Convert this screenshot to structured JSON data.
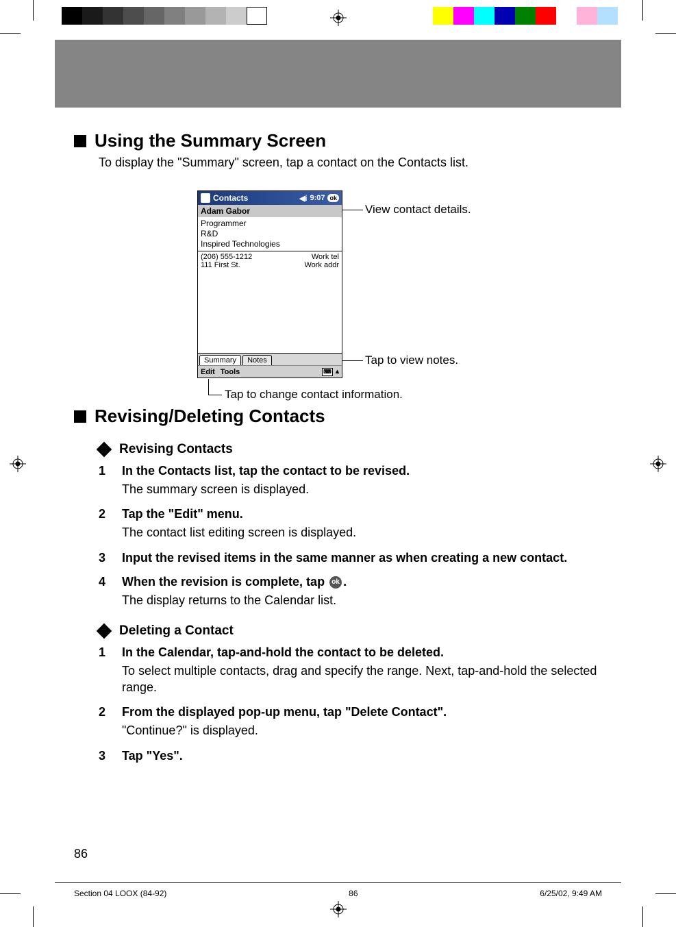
{
  "section1": {
    "heading": "Using the Summary Screen",
    "intro": "To display the \"Summary\" screen, tap a contact on the Contacts list."
  },
  "ppc": {
    "title": "Contacts",
    "time": "9:07",
    "ok": "ok",
    "name": "Adam Gabor",
    "role": "Programmer",
    "dept": "R&D",
    "company": "Inspired Technologies",
    "phone": "(206) 555-1212",
    "phone_label": "Work tel",
    "addr": "111 First St.",
    "addr_label": "Work addr",
    "tab_summary": "Summary",
    "tab_notes": "Notes",
    "menu_edit": "Edit",
    "menu_tools": "Tools"
  },
  "callouts": {
    "view_details": "View contact details.",
    "view_notes": "Tap to view notes.",
    "change_info": "Tap to change contact information."
  },
  "section2": {
    "heading": "Revising/Deleting Contacts"
  },
  "revising": {
    "heading": "Revising Contacts",
    "steps": [
      {
        "num": "1",
        "title": "In the Contacts list, tap the contact to be revised.",
        "body": "The summary screen is displayed."
      },
      {
        "num": "2",
        "title": "Tap the \"Edit\" menu.",
        "body": "The contact list editing screen is displayed."
      },
      {
        "num": "3",
        "title": "Input the revised items in the same manner as when creating a new contact.",
        "body": ""
      },
      {
        "num": "4",
        "title_pre": "When the revision is complete, tap ",
        "title_post": ".",
        "body": "The display returns to the Calendar list."
      }
    ]
  },
  "deleting": {
    "heading": "Deleting a Contact",
    "steps": [
      {
        "num": "1",
        "title": "In the Calendar, tap-and-hold the contact to be deleted.",
        "body": "To select multiple contacts, drag and specify the range. Next, tap-and-hold the selected range."
      },
      {
        "num": "2",
        "title": "From the displayed pop-up menu, tap \"Delete Contact\".",
        "body": "\"Continue?\" is displayed."
      },
      {
        "num": "3",
        "title": "Tap \"Yes\".",
        "body": ""
      }
    ]
  },
  "page_number": "86",
  "footer": {
    "left": "Section 04 LOOX (84-92)",
    "center": "86",
    "right": "6/25/02, 9:49 AM"
  },
  "colorbars_left": [
    "#000",
    "#1a1a1a",
    "#333",
    "#4d4d4d",
    "#666",
    "#808080",
    "#999",
    "#b3b3b3",
    "#ccc",
    "#fff"
  ],
  "colorbars_right": [
    "#ffff00",
    "#ff00ff",
    "#00ffff",
    "#0000b3",
    "#008000",
    "#ff0000",
    "#ffffff",
    "#ffb3d9",
    "#b3e0ff"
  ]
}
